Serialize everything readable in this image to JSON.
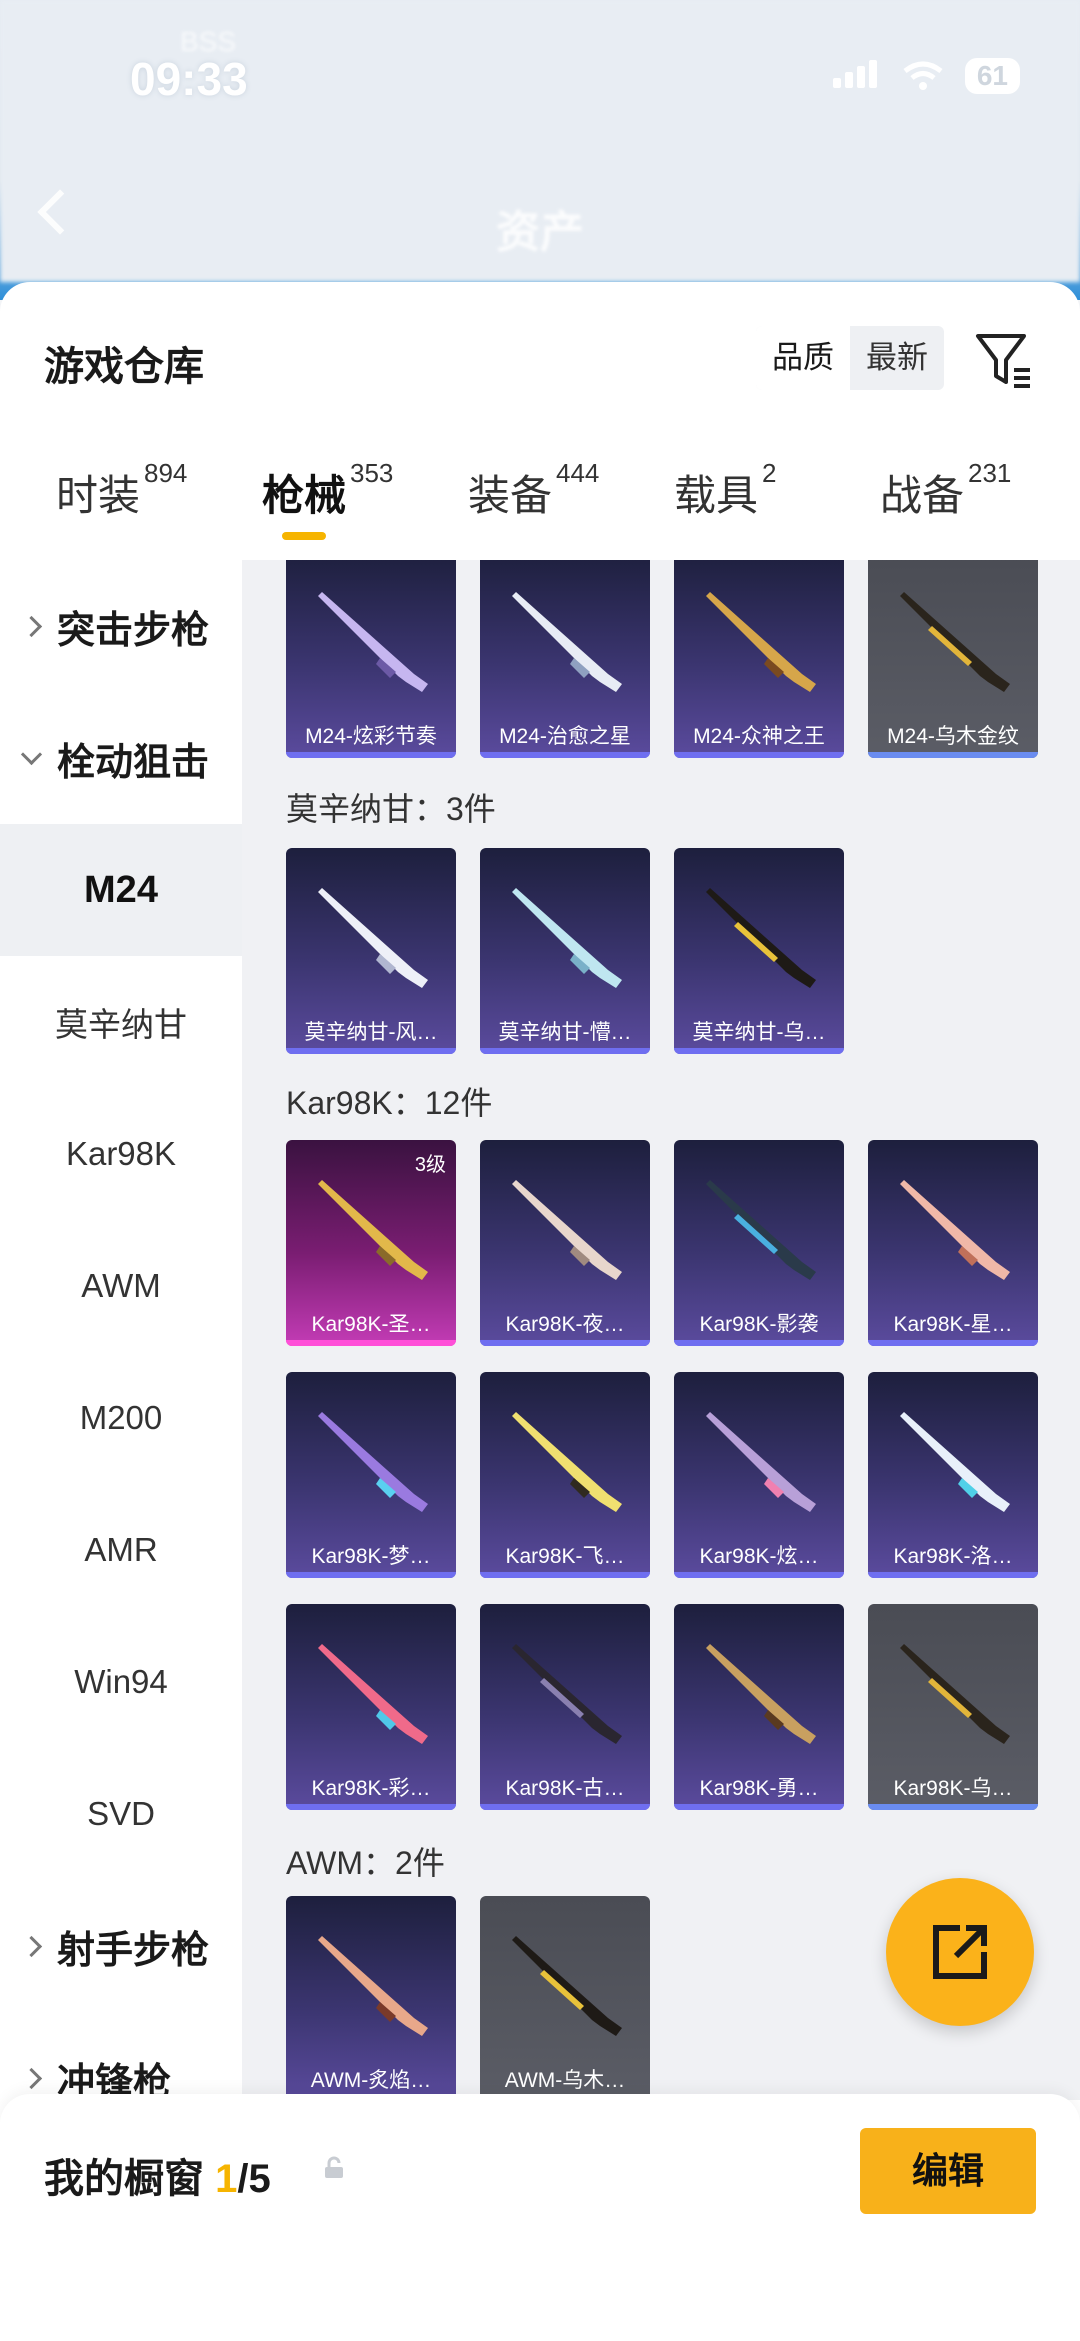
{
  "status_bar": {
    "time": "09:33",
    "carrier": "BSS",
    "battery": "61"
  },
  "nav": {
    "title": "资产"
  },
  "panel": {
    "title": "游戏仓库",
    "sort_options": [
      "品质",
      "最新"
    ],
    "tabs": [
      {
        "label": "时装",
        "count": "894"
      },
      {
        "label": "枪械",
        "count": "353"
      },
      {
        "label": "装备",
        "count": "444"
      },
      {
        "label": "载具",
        "count": "2"
      },
      {
        "label": "战备",
        "count": "231"
      }
    ]
  },
  "sidebar": {
    "items": [
      {
        "label": "突击步枪",
        "type": "group",
        "expanded": false
      },
      {
        "label": "栓动狙击",
        "type": "group",
        "expanded": true
      },
      {
        "label": "M24",
        "type": "sub",
        "selected": true
      },
      {
        "label": "莫辛纳甘",
        "type": "sub"
      },
      {
        "label": "Kar98K",
        "type": "sub"
      },
      {
        "label": "AWM",
        "type": "sub"
      },
      {
        "label": "M200",
        "type": "sub"
      },
      {
        "label": "AMR",
        "type": "sub"
      },
      {
        "label": "Win94",
        "type": "sub"
      },
      {
        "label": "SVD",
        "type": "sub"
      },
      {
        "label": "射手步枪",
        "type": "group",
        "expanded": false
      },
      {
        "label": "冲锋枪",
        "type": "group",
        "expanded": false
      }
    ]
  },
  "sections": {
    "mosin": "莫辛纳甘：3件",
    "kar": "Kar98K：12件",
    "awm": "AWM：2件"
  },
  "cards": {
    "m24": [
      "M24-炫彩节奏",
      "M24-治愈之星",
      "M24-众神之王",
      "M24-乌木金纹"
    ],
    "mosin": [
      "莫辛纳甘-风…",
      "莫辛纳甘-懵…",
      "莫辛纳甘-乌…"
    ],
    "kar": [
      "Kar98K-圣…",
      "Kar98K-夜…",
      "Kar98K-影袭",
      "Kar98K-星…",
      "Kar98K-梦…",
      "Kar98K-飞…",
      "Kar98K-炫…",
      "Kar98K-洛…",
      "Kar98K-彩…",
      "Kar98K-古…",
      "Kar98K-勇…",
      "Kar98K-乌…"
    ],
    "awm": [
      "AWM-炙焰…",
      "AWM-乌木…"
    ],
    "level_badge": "3级"
  },
  "showcase": {
    "title": "我的橱窗",
    "current": "1",
    "total": "/5",
    "edit_label": "编辑"
  },
  "colors": {
    "accent": "#f6b400",
    "card_purple": "#3b3570",
    "card_grey": "#555760",
    "card_pink": "#c43cb6"
  }
}
